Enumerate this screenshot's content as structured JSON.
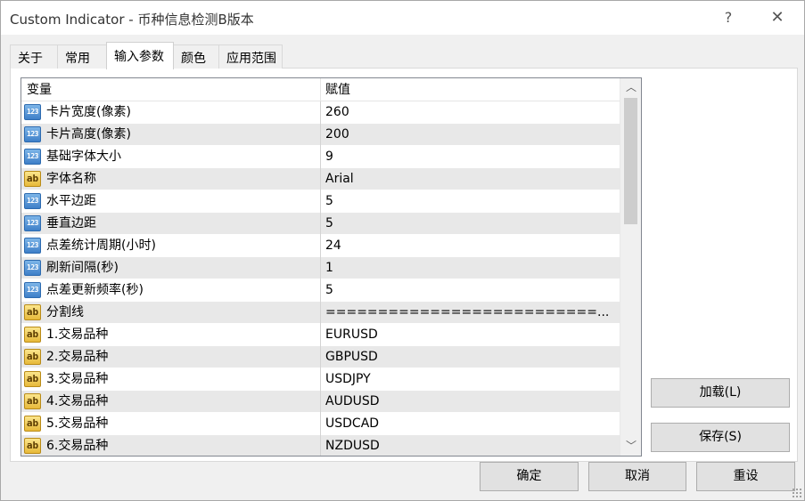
{
  "window": {
    "title": "Custom Indicator - 币种信息检测B版本",
    "help_glyph": "?",
    "close_glyph": "✕"
  },
  "tabs": [
    {
      "label": "关于",
      "active": false
    },
    {
      "label": "常用",
      "active": false
    },
    {
      "label": "输入参数",
      "active": true
    },
    {
      "label": "颜色",
      "active": false
    },
    {
      "label": "应用范围",
      "active": false
    }
  ],
  "grid": {
    "headers": {
      "variable": "变量",
      "value": "赋值"
    },
    "rows": [
      {
        "type": "num",
        "icon_text": "123",
        "name": "卡片宽度(像素)",
        "value": "260"
      },
      {
        "type": "num",
        "icon_text": "123",
        "name": "卡片高度(像素)",
        "value": "200"
      },
      {
        "type": "num",
        "icon_text": "123",
        "name": "基础字体大小",
        "value": "9"
      },
      {
        "type": "str",
        "icon_text": "ab",
        "name": "字体名称",
        "value": "Arial"
      },
      {
        "type": "num",
        "icon_text": "123",
        "name": "水平边距",
        "value": "5"
      },
      {
        "type": "num",
        "icon_text": "123",
        "name": "垂直边距",
        "value": "5"
      },
      {
        "type": "num",
        "icon_text": "123",
        "name": "点差统计周期(小时)",
        "value": "24"
      },
      {
        "type": "num",
        "icon_text": "123",
        "name": "刷新间隔(秒)",
        "value": "1"
      },
      {
        "type": "num",
        "icon_text": "123",
        "name": "点差更新频率(秒)",
        "value": "5"
      },
      {
        "type": "str",
        "icon_text": "ab",
        "name": "分割线",
        "value": "==========================..."
      },
      {
        "type": "str",
        "icon_text": "ab",
        "name": "1.交易品种",
        "value": "EURUSD"
      },
      {
        "type": "str",
        "icon_text": "ab",
        "name": "2.交易品种",
        "value": "GBPUSD"
      },
      {
        "type": "str",
        "icon_text": "ab",
        "name": "3.交易品种",
        "value": "USDJPY"
      },
      {
        "type": "str",
        "icon_text": "ab",
        "name": "4.交易品种",
        "value": "AUDUSD"
      },
      {
        "type": "str",
        "icon_text": "ab",
        "name": "5.交易品种",
        "value": "USDCAD"
      },
      {
        "type": "str",
        "icon_text": "ab",
        "name": "6.交易品种",
        "value": "NZDUSD"
      }
    ],
    "scroll_up_glyph": "︿",
    "scroll_down_glyph": "﹀"
  },
  "buttons": {
    "load": "加载(L)",
    "save": "保存(S)",
    "ok": "确定",
    "cancel": "取消",
    "reset": "重设"
  }
}
